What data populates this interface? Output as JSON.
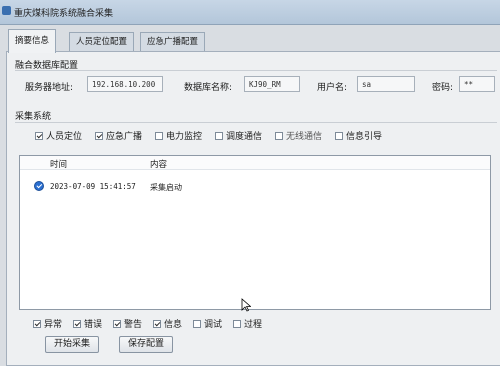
{
  "window": {
    "title": "重庆煤科院系统融合采集"
  },
  "tabs": [
    {
      "label": "摘要信息",
      "active": true
    },
    {
      "label": "人员定位配置",
      "active": false
    },
    {
      "label": "应急广播配置",
      "active": false
    }
  ],
  "db_config": {
    "section_title": "融合数据库配置",
    "server_label": "服务器地址:",
    "server_value": "192.168.10.200",
    "dbname_label": "数据库名称:",
    "dbname_value": "KJ90_RM",
    "user_label": "用户名:",
    "user_value": "sa",
    "password_label": "密码:",
    "password_value": "**"
  },
  "collect_system": {
    "section_title": "采集系统",
    "items": [
      {
        "label": "人员定位",
        "checked": true,
        "enabled": true
      },
      {
        "label": "应急广播",
        "checked": true,
        "enabled": true
      },
      {
        "label": "电力监控",
        "checked": false,
        "enabled": true
      },
      {
        "label": "调度通信",
        "checked": false,
        "enabled": true
      },
      {
        "label": "无线通信",
        "checked": false,
        "enabled": false
      },
      {
        "label": "信息引导",
        "checked": false,
        "enabled": true
      }
    ]
  },
  "log": {
    "col_time": "时间",
    "col_content": "内容",
    "rows": [
      {
        "time": "2023-07-09 15:41:57",
        "content": "采集启动",
        "icon": "success-check-icon"
      }
    ]
  },
  "filters": [
    {
      "label": "异常",
      "checked": true
    },
    {
      "label": "错误",
      "checked": true
    },
    {
      "label": "警告",
      "checked": true
    },
    {
      "label": "信息",
      "checked": true
    },
    {
      "label": "调试",
      "checked": false
    },
    {
      "label": "过程",
      "checked": false
    }
  ],
  "buttons": {
    "start": "开始采集",
    "save": "保存配置"
  }
}
